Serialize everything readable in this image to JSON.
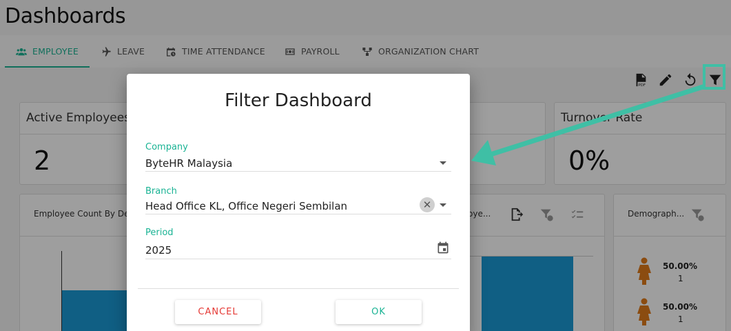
{
  "page": {
    "title": "Dashboards"
  },
  "tabs": [
    {
      "label": "EMPLOYEE",
      "icon": "users-icon",
      "active": true
    },
    {
      "label": "LEAVE",
      "icon": "plane-icon"
    },
    {
      "label": "TIME ATTENDANCE",
      "icon": "calendar-clock-icon"
    },
    {
      "label": "PAYROLL",
      "icon": "money-icon"
    },
    {
      "label": "ORGANIZATION CHART",
      "icon": "org-chart-icon"
    }
  ],
  "toolbar": {
    "icons": [
      "pdf-icon",
      "pencil-icon",
      "undo-icon",
      "filter-icon"
    ]
  },
  "cards": {
    "active_employees": {
      "title": "Active Employees",
      "value": "2"
    },
    "turnover_rate": {
      "title": "Turnover Rate",
      "value": "0%"
    }
  },
  "panels": {
    "count_by_dept": {
      "title": "Employee Count By De"
    },
    "middle": {
      "title": "oye..."
    },
    "demographic": {
      "title": "Demograph...",
      "rows": [
        {
          "percent": "50.00%",
          "count": "1"
        },
        {
          "percent": "50.00%",
          "count": "1"
        }
      ]
    }
  },
  "dialog": {
    "title": "Filter Dashboard",
    "company": {
      "label": "Company",
      "value": "ByteHR Malaysia"
    },
    "branch": {
      "label": "Branch",
      "value": "Head Office KL, Office Negeri Sembilan"
    },
    "period": {
      "label": "Period",
      "value": "2025"
    },
    "cancel_label": "CANCEL",
    "ok_label": "OK"
  },
  "colors": {
    "accent": "#1ab394",
    "bar": "#1a9ad6",
    "person": "#e07b1a",
    "cancel": "#e53935"
  }
}
